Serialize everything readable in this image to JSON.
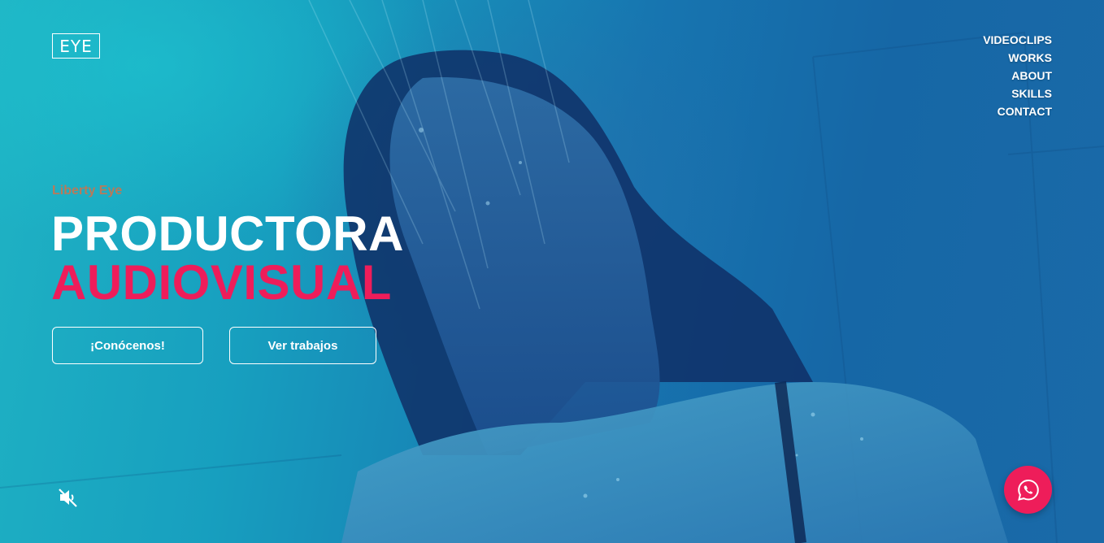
{
  "brand": {
    "logo_text": "EYE",
    "accent_color": "#ee1d5a",
    "eyebrow_color": "#b87a5a"
  },
  "nav": {
    "items": [
      {
        "label": "VIDEOCLIPS"
      },
      {
        "label": "WORKS"
      },
      {
        "label": "ABOUT"
      },
      {
        "label": "SKILLS"
      },
      {
        "label": "CONTACT"
      }
    ]
  },
  "hero": {
    "eyebrow": "Liberty Eye",
    "title_line1": "PRODUCTORA",
    "title_line2": "AUDIOVISUAL",
    "background": "video of a woman under falling water, blue/teal tint"
  },
  "buttons": {
    "about_label": "¡Conócenos!",
    "works_label": "Ver trabajos"
  },
  "controls": {
    "mute_icon": "speaker-muted-icon",
    "whatsapp_icon": "whatsapp-icon"
  }
}
